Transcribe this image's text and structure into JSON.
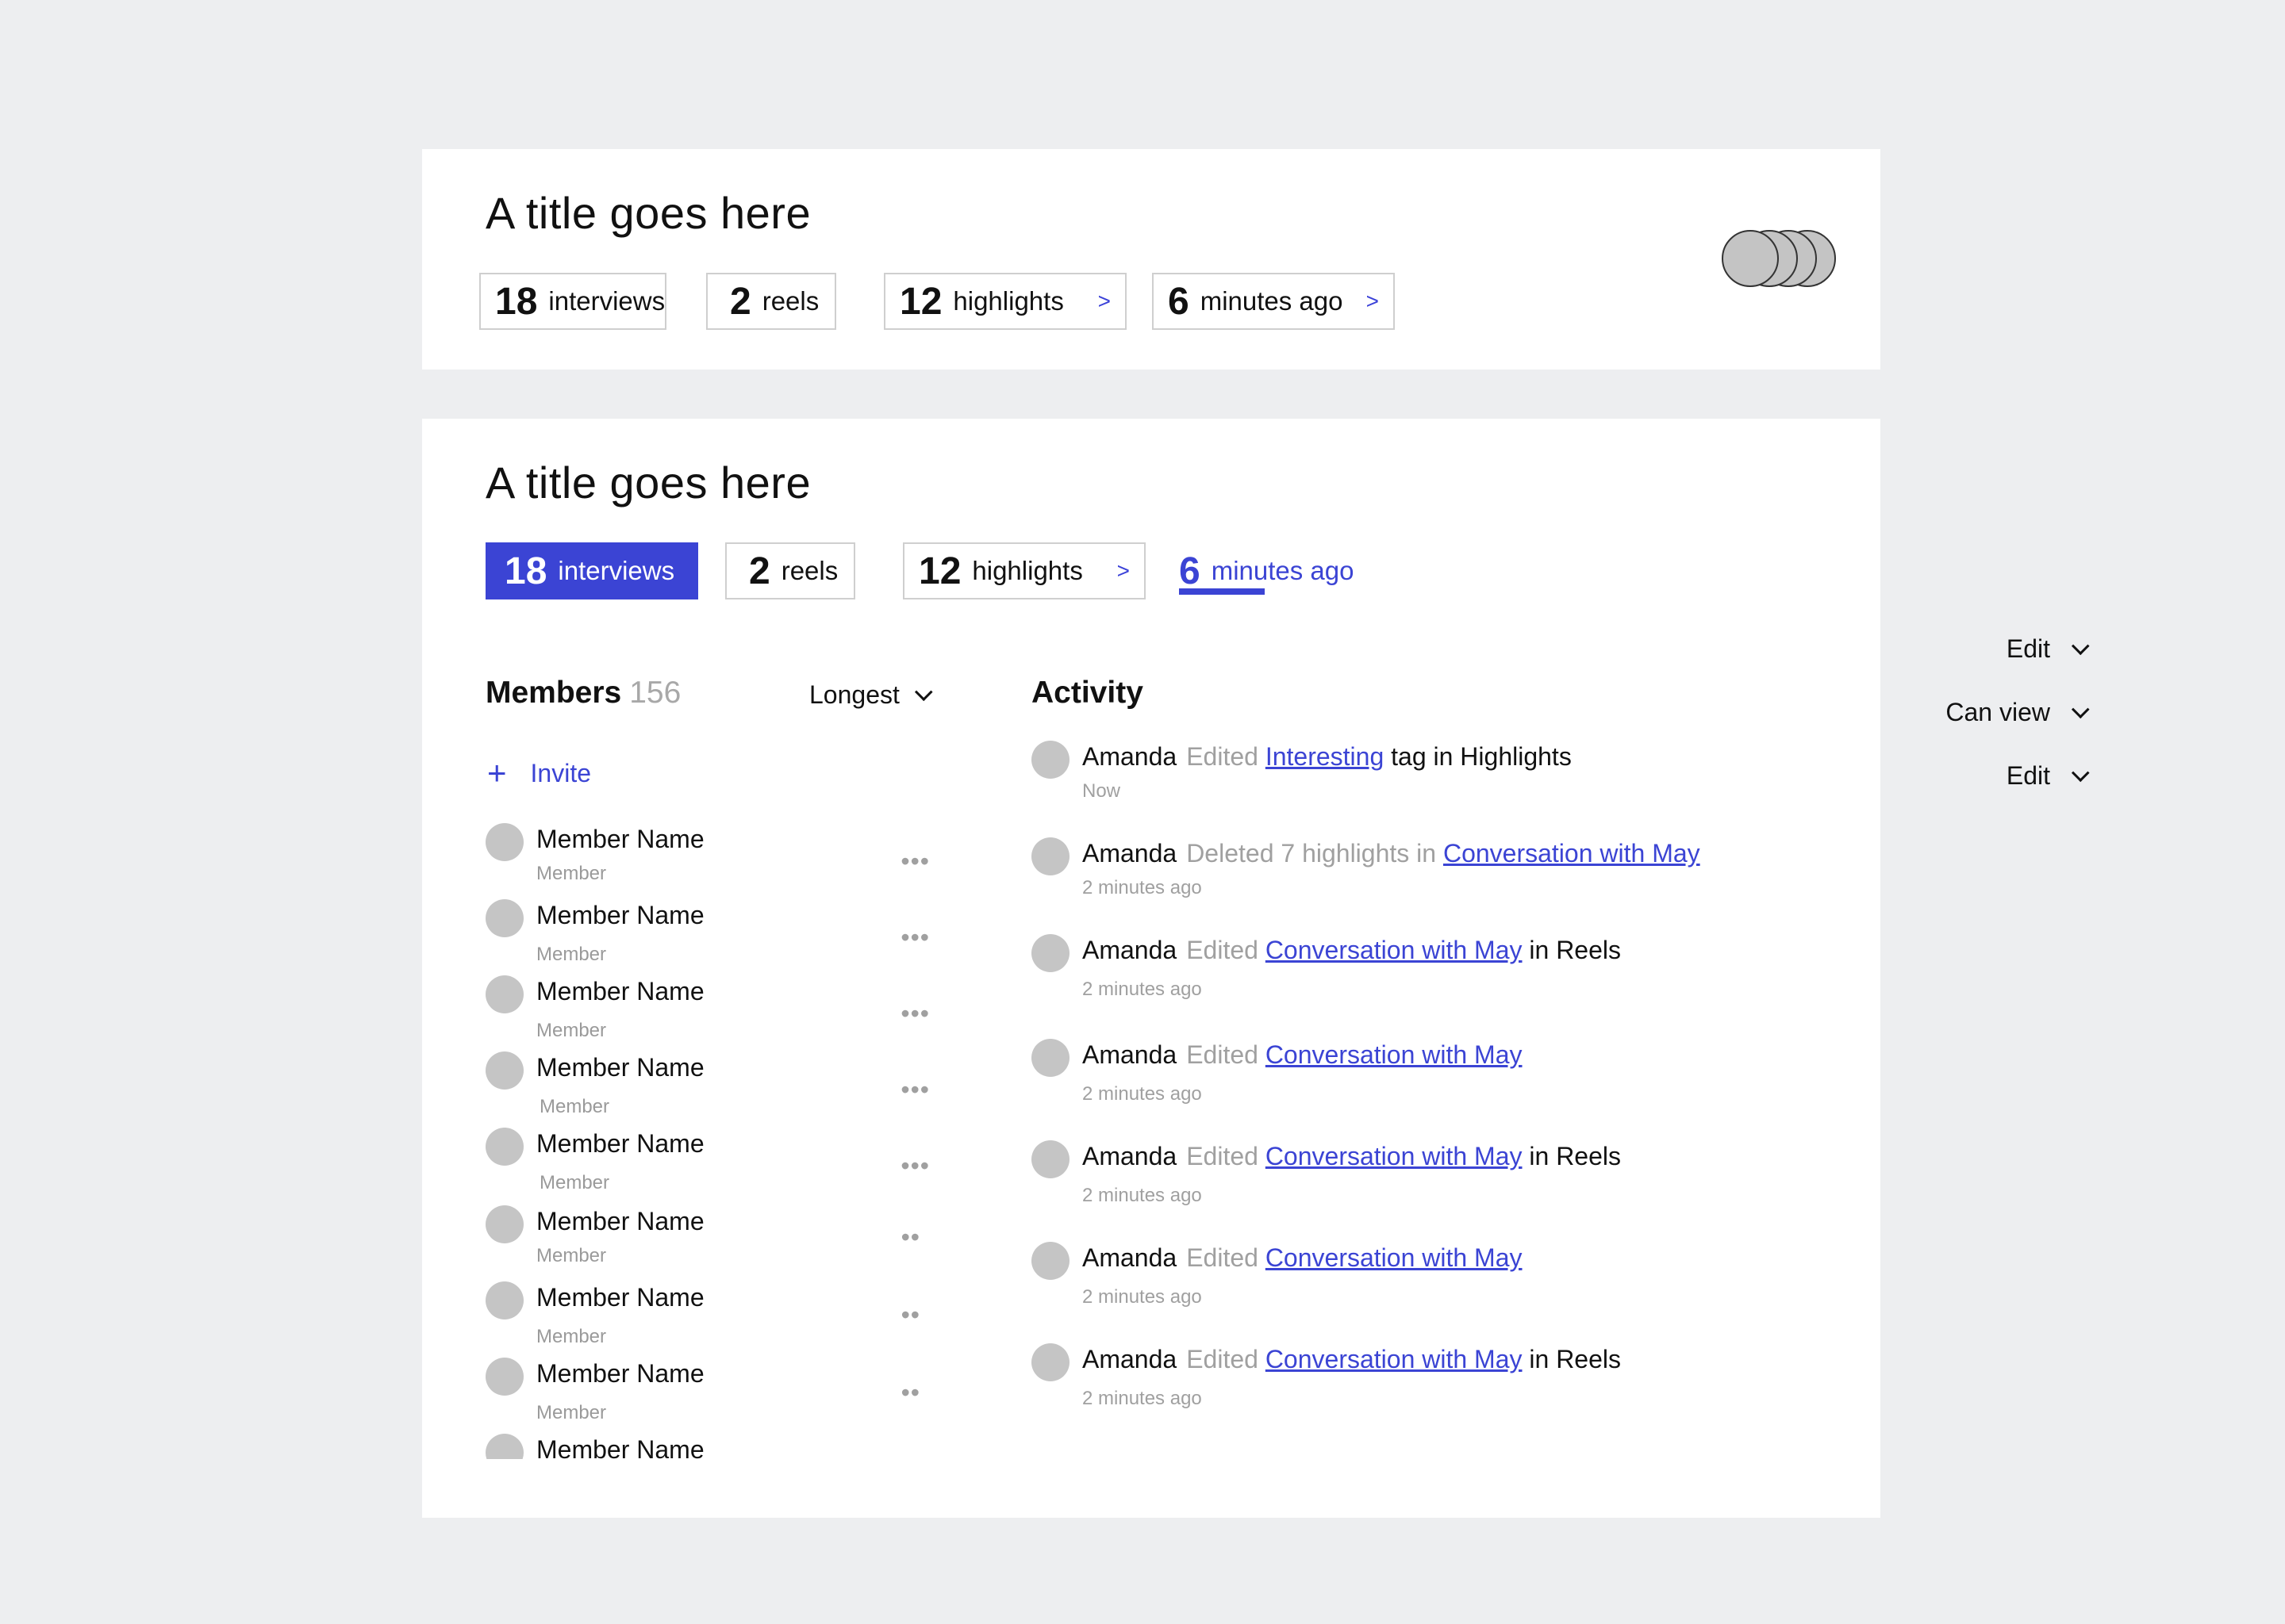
{
  "card1": {
    "title": "A title goes here",
    "stats": [
      {
        "num": "18",
        "label": "interviews"
      },
      {
        "num": "2",
        "label": "reels"
      },
      {
        "num": "12",
        "label": "highlights",
        "chev": ">"
      },
      {
        "num": "6",
        "label": "minutes ago",
        "chev": ">"
      }
    ]
  },
  "card2": {
    "title": "A title goes here",
    "stats": [
      {
        "num": "18",
        "label": "interviews"
      },
      {
        "num": "2",
        "label": "reels"
      },
      {
        "num": "12",
        "label": "highlights",
        "chev": ">"
      },
      {
        "num": "6",
        "label": "minutes ago"
      }
    ],
    "members": {
      "heading": "Members",
      "count": "156",
      "sort": "Longest",
      "invite": "Invite",
      "items": [
        {
          "name": "Member Name",
          "role": "Member",
          "more": "•••"
        },
        {
          "name": "Member Name",
          "role": "Member",
          "more": "•••"
        },
        {
          "name": "Member Name",
          "role": "Member",
          "more": "•••"
        },
        {
          "name": "Member Name",
          "role": "Member",
          "more": "•••"
        },
        {
          "name": "Member Name",
          "role": "Member",
          "more": "•••"
        },
        {
          "name": "Member Name",
          "role": "Member",
          "more": "••"
        },
        {
          "name": "Member Name",
          "role": "Member",
          "more": "••"
        },
        {
          "name": "Member Name",
          "role": "Member",
          "more": "••"
        },
        {
          "name": "Member Name",
          "role": "",
          "more": ""
        }
      ]
    },
    "activity": {
      "heading": "Activity",
      "items": [
        {
          "who": "Amanda",
          "verb": "Edited",
          "link": "Interesting",
          "rest": "tag in Highlights",
          "time": "Now"
        },
        {
          "who": "Amanda",
          "verb": "Deleted 7 highlights in",
          "link": "Conversation with May",
          "rest": "",
          "time": "2 minutes ago"
        },
        {
          "who": "Amanda",
          "verb": "Edited",
          "link": "Conversation with May",
          "rest": "in Reels",
          "time": "2 minutes ago"
        },
        {
          "who": "Amanda",
          "verb": "Edited",
          "link": "Conversation with May",
          "rest": "",
          "time": "2 minutes ago"
        },
        {
          "who": "Amanda",
          "verb": "Edited",
          "link": "Conversation with May",
          "rest": "in Reels",
          "time": "2 minutes ago"
        },
        {
          "who": "Amanda",
          "verb": "Edited",
          "link": "Conversation with May",
          "rest": "",
          "time": "2 minutes ago"
        },
        {
          "who": "Amanda",
          "verb": "Edited",
          "link": "Conversation with May",
          "rest": "in Reels",
          "time": "2 minutes ago"
        }
      ]
    }
  },
  "permissions": [
    "Edit",
    "Can view",
    "Edit"
  ],
  "colors": {
    "accent": "#3b44d4",
    "background": "#edeef0",
    "muted": "#a0a0a0",
    "avatar": "#c5c5c5"
  }
}
